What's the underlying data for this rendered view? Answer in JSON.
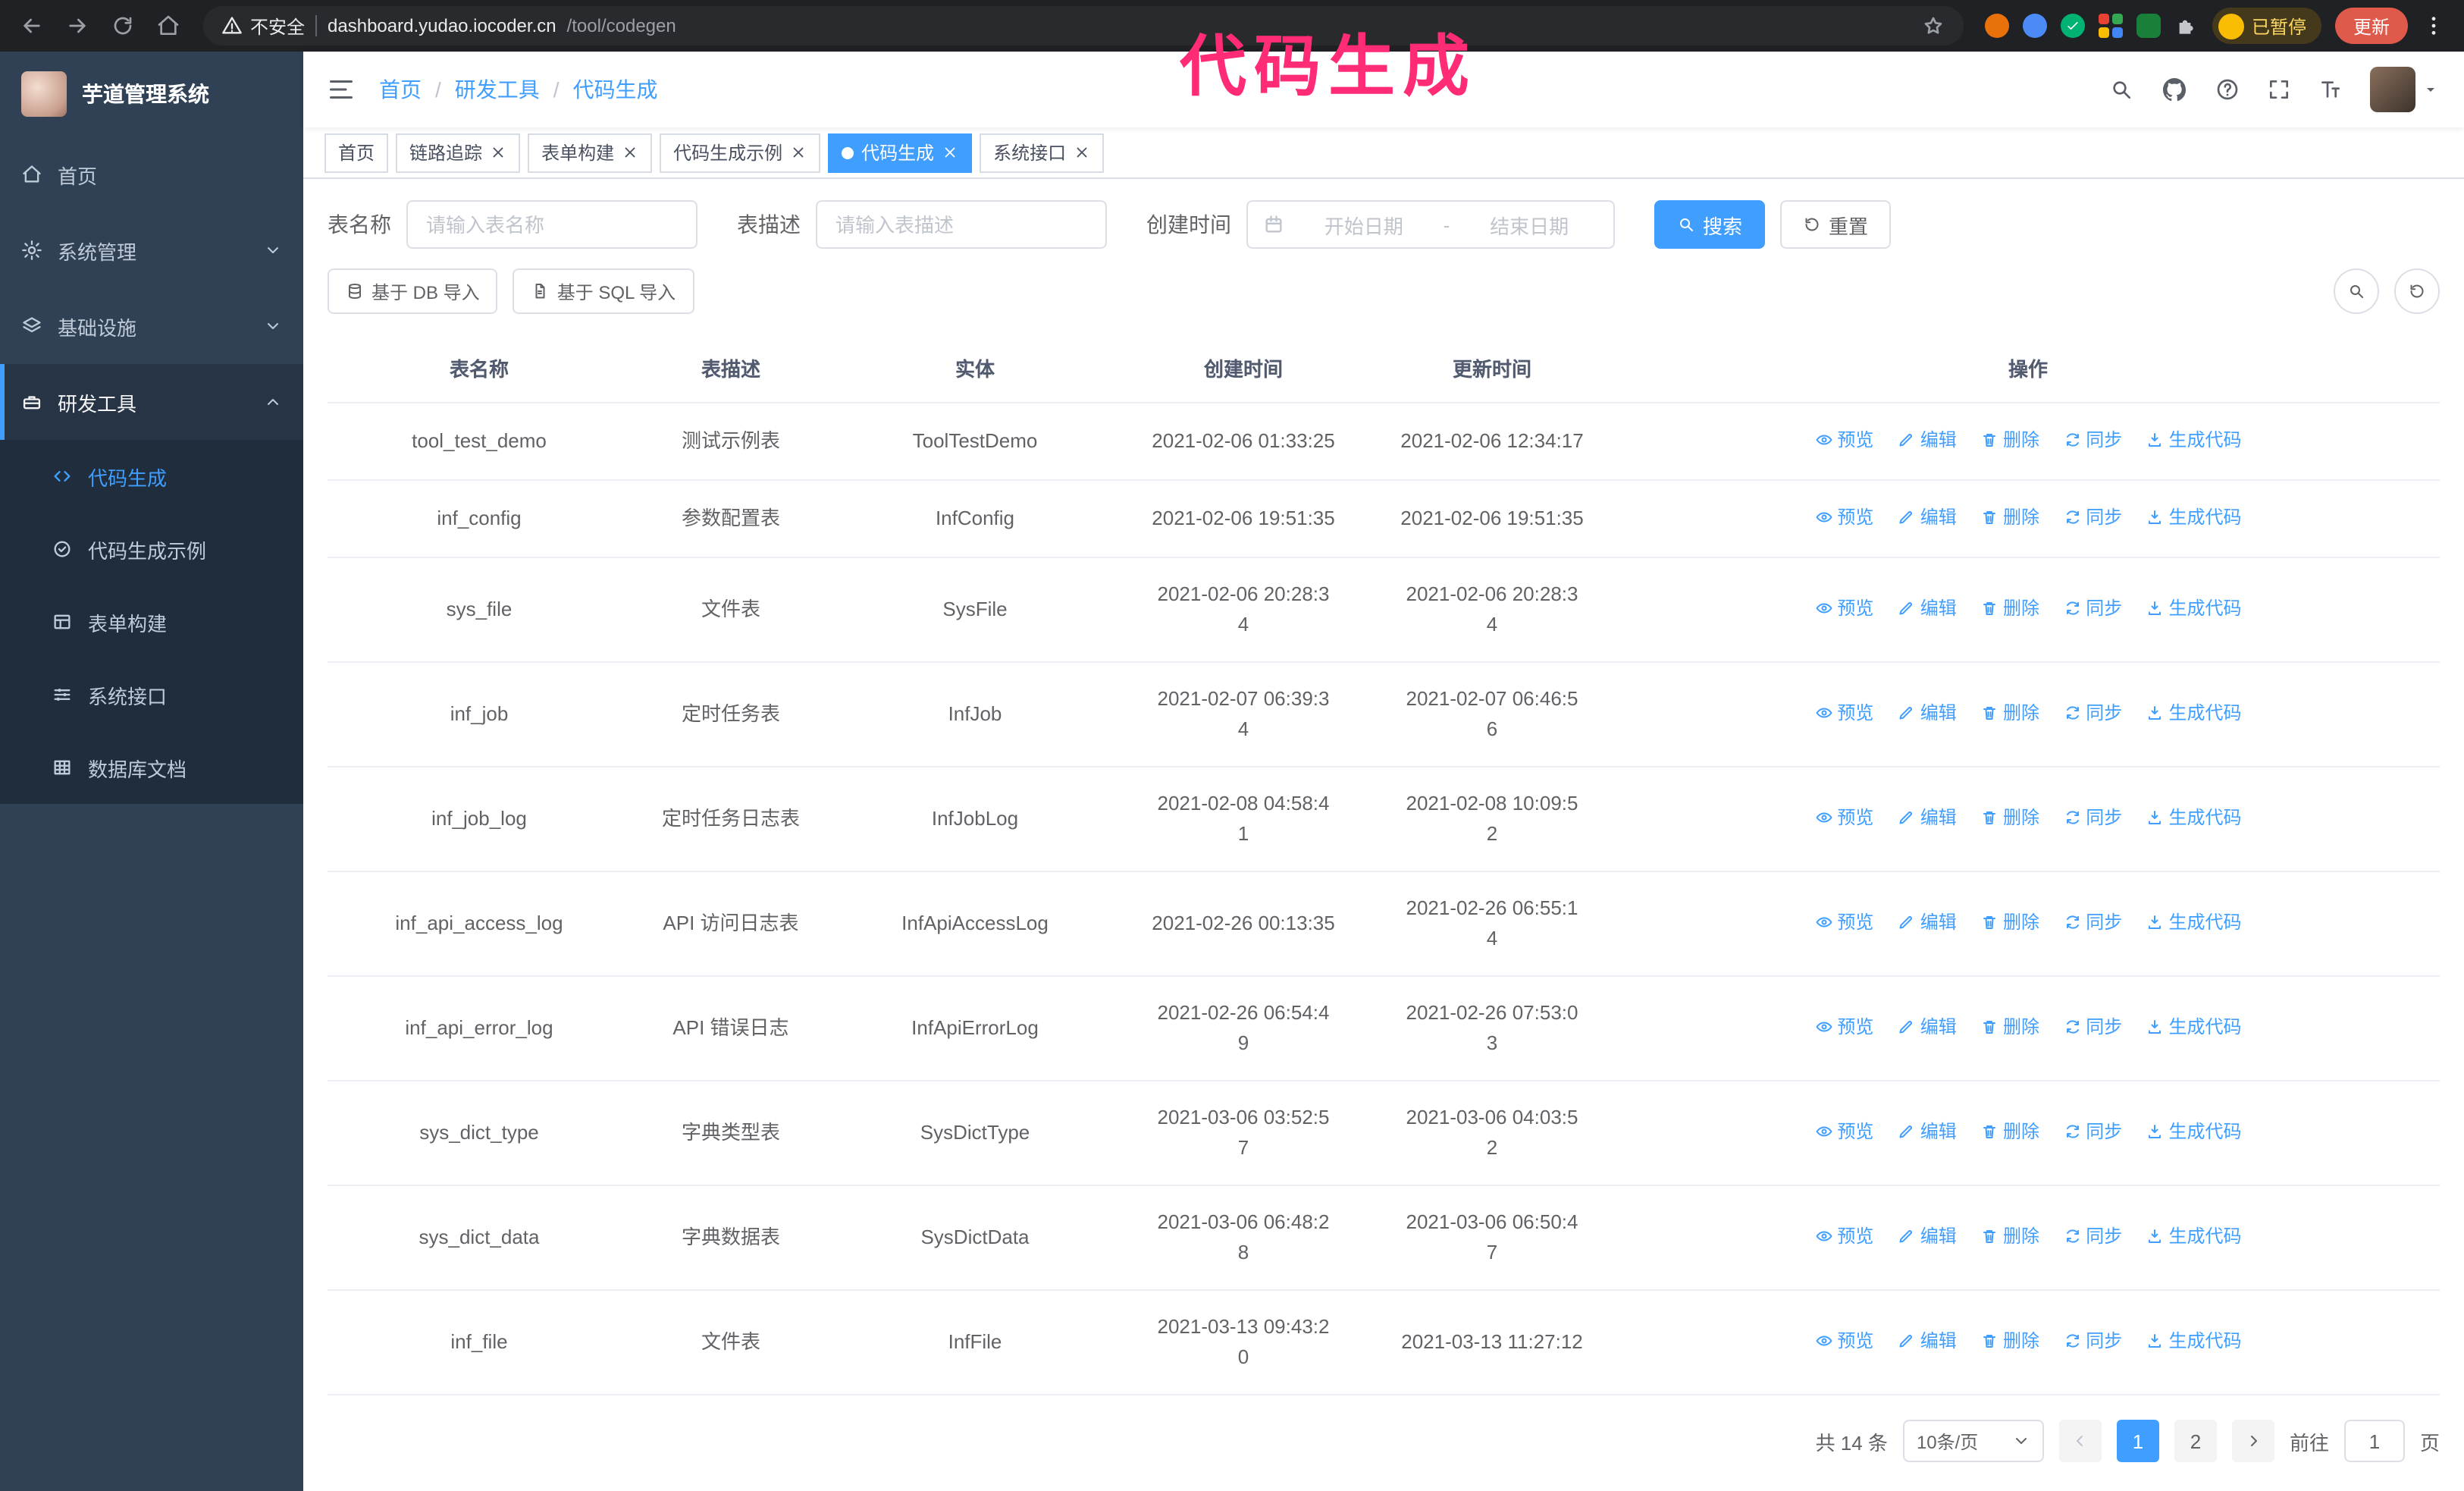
{
  "colors": {
    "primary": "#409eff",
    "sidebar_bg": "#304156",
    "submenu_bg": "#1f2d3d",
    "annotation": "#ff2b77"
  },
  "browser": {
    "security_label": "不安全",
    "url_host": "dashboard.yudao.iocoder.cn",
    "url_path": "/tool/codegen",
    "paused_badge": "已暂停",
    "update_button": "更新"
  },
  "annotation": {
    "text": "代码生成"
  },
  "sidebar": {
    "logo_title": "芋道管理系统",
    "items": [
      {
        "label": "首页"
      },
      {
        "label": "系统管理"
      },
      {
        "label": "基础设施"
      },
      {
        "label": "研发工具",
        "expanded": true
      }
    ],
    "submenu": [
      {
        "label": "代码生成",
        "active": true
      },
      {
        "label": "代码生成示例"
      },
      {
        "label": "表单构建"
      },
      {
        "label": "系统接口"
      },
      {
        "label": "数据库文档"
      }
    ]
  },
  "header": {
    "breadcrumb": [
      "首页",
      "研发工具",
      "代码生成"
    ],
    "separator": "/"
  },
  "tabs": [
    {
      "label": "首页"
    },
    {
      "label": "链路追踪"
    },
    {
      "label": "表单构建"
    },
    {
      "label": "代码生成示例"
    },
    {
      "label": "代码生成",
      "active": true
    },
    {
      "label": "系统接口"
    }
  ],
  "filters": {
    "table_name_label": "表名称",
    "table_name_placeholder": "请输入表名称",
    "table_desc_label": "表描述",
    "table_desc_placeholder": "请输入表描述",
    "create_time_label": "创建时间",
    "date_start_placeholder": "开始日期",
    "date_separator": "-",
    "date_end_placeholder": "结束日期",
    "search_button": "搜索",
    "reset_button": "重置"
  },
  "toolbar": {
    "import_db_button": "基于 DB 导入",
    "import_sql_button": "基于 SQL 导入"
  },
  "table": {
    "columns": [
      "表名称",
      "表描述",
      "实体",
      "创建时间",
      "更新时间",
      "操作"
    ],
    "actions": [
      "预览",
      "编辑",
      "删除",
      "同步",
      "生成代码"
    ],
    "rows": [
      {
        "name": "tool_test_demo",
        "desc": "测试示例表",
        "entity": "ToolTestDemo",
        "created": "2021-02-06 01:33:25",
        "updated": "2021-02-06 12:34:17"
      },
      {
        "name": "inf_config",
        "desc": "参数配置表",
        "entity": "InfConfig",
        "created": "2021-02-06 19:51:35",
        "updated": "2021-02-06 19:51:35"
      },
      {
        "name": "sys_file",
        "desc": "文件表",
        "entity": "SysFile",
        "created": "2021-02-06 20:28:3\n4",
        "updated": "2021-02-06 20:28:3\n4"
      },
      {
        "name": "inf_job",
        "desc": "定时任务表",
        "entity": "InfJob",
        "created": "2021-02-07 06:39:3\n4",
        "updated": "2021-02-07 06:46:5\n6"
      },
      {
        "name": "inf_job_log",
        "desc": "定时任务日志表",
        "entity": "InfJobLog",
        "created": "2021-02-08 04:58:4\n1",
        "updated": "2021-02-08 10:09:5\n2"
      },
      {
        "name": "inf_api_access_log",
        "desc": "API 访问日志表",
        "entity": "InfApiAccessLog",
        "created": "2021-02-26 00:13:35",
        "updated": "2021-02-26 06:55:1\n4"
      },
      {
        "name": "inf_api_error_log",
        "desc": "API 错误日志",
        "entity": "InfApiErrorLog",
        "created": "2021-02-26 06:54:4\n9",
        "updated": "2021-02-26 07:53:0\n3"
      },
      {
        "name": "sys_dict_type",
        "desc": "字典类型表",
        "entity": "SysDictType",
        "created": "2021-03-06 03:52:5\n7",
        "updated": "2021-03-06 04:03:5\n2"
      },
      {
        "name": "sys_dict_data",
        "desc": "字典数据表",
        "entity": "SysDictData",
        "created": "2021-03-06 06:48:2\n8",
        "updated": "2021-03-06 06:50:4\n7"
      },
      {
        "name": "inf_file",
        "desc": "文件表",
        "entity": "InfFile",
        "created": "2021-03-13 09:43:2\n0",
        "updated": "2021-03-13 11:27:12"
      }
    ]
  },
  "pagination": {
    "total": "共 14 条",
    "page_size": "10条/页",
    "pages": [
      "1",
      "2"
    ],
    "active_page": "1",
    "goto_label": "前往",
    "goto_value": "1",
    "page_suffix": "页"
  }
}
